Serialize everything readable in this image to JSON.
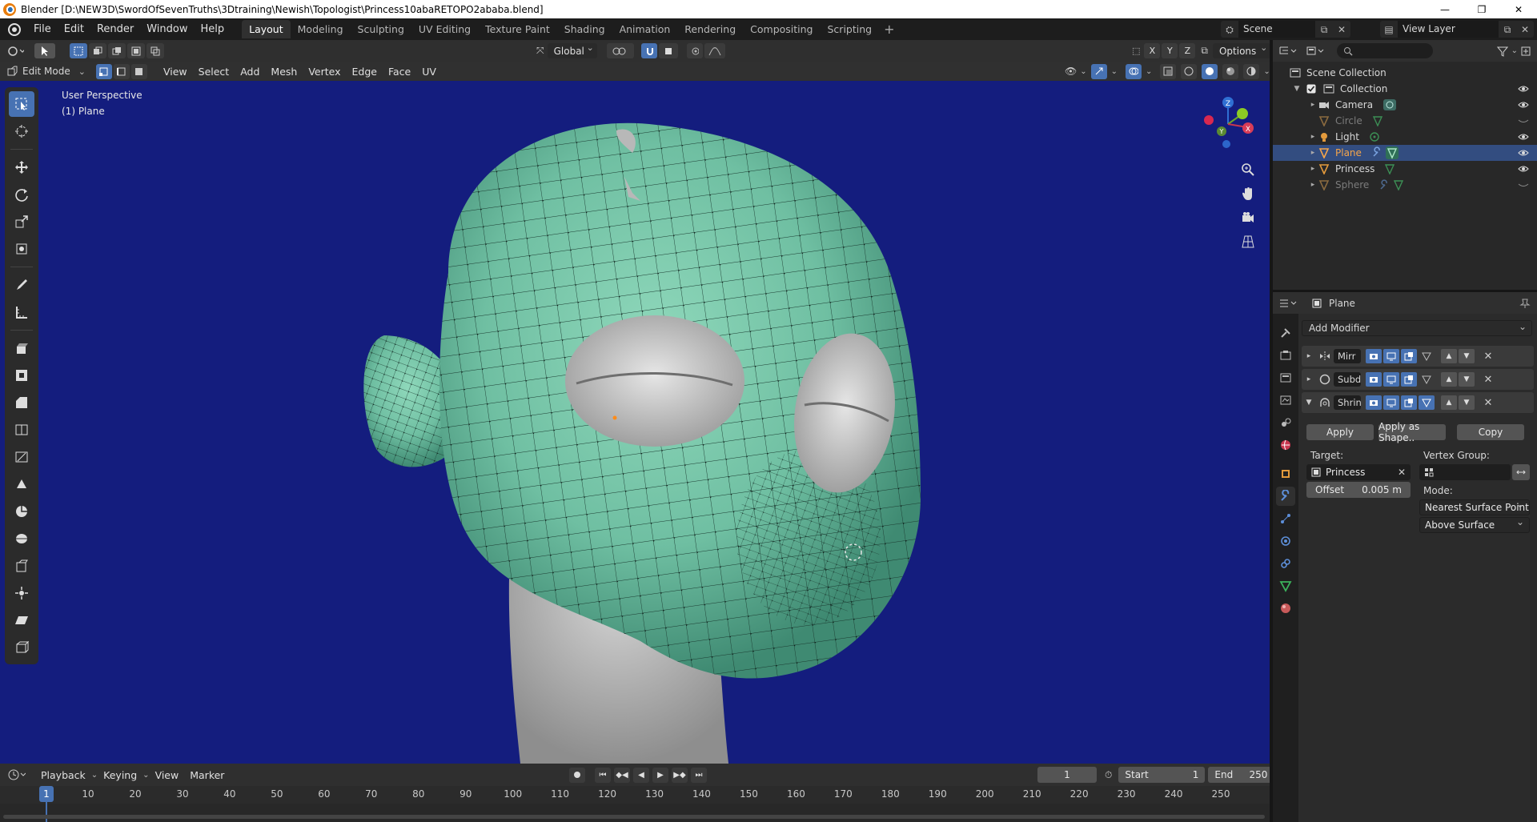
{
  "window": {
    "title": "Blender [D:\\NEW3D\\SwordOfSevenTruths\\3Dtraining\\Newish\\Topologist\\Princess10abaRETOPO2ababa.blend]",
    "minimize": "—",
    "maximize": "❐",
    "close": "✕"
  },
  "menu": [
    "File",
    "Edit",
    "Render",
    "Window",
    "Help"
  ],
  "workspaces": [
    "Layout",
    "Modeling",
    "Sculpting",
    "UV Editing",
    "Texture Paint",
    "Shading",
    "Animation",
    "Rendering",
    "Compositing",
    "Scripting"
  ],
  "workspace_add": "+",
  "scene": "Scene",
  "view_layer": "View Layer",
  "viewport_header": {
    "orientation": "Global",
    "options": "Options",
    "axes": [
      "X",
      "Y",
      "Z"
    ]
  },
  "viewport_header2": {
    "mode": "Edit Mode",
    "menus": [
      "View",
      "Select",
      "Add",
      "Mesh",
      "Vertex",
      "Edge",
      "Face",
      "UV"
    ]
  },
  "viewport": {
    "perspective": "User Perspective",
    "object": "(1) Plane",
    "background_color": "#141d7e",
    "mesh_color": "#6fbfa2"
  },
  "gizmo_axes": [
    "Z",
    "Y",
    "X"
  ],
  "outliner": {
    "root": "Scene Collection",
    "collection": "Collection",
    "items": [
      {
        "name": "Camera",
        "type": "camera",
        "dim": false,
        "visible": true
      },
      {
        "name": "Circle",
        "type": "mesh",
        "dim": true,
        "visible": false
      },
      {
        "name": "Light",
        "type": "light",
        "dim": false,
        "visible": true
      },
      {
        "name": "Plane",
        "type": "mesh",
        "dim": false,
        "visible": true,
        "selected": true
      },
      {
        "name": "Princess",
        "type": "mesh",
        "dim": false,
        "visible": true
      },
      {
        "name": "Sphere",
        "type": "mesh",
        "dim": true,
        "visible": false
      }
    ]
  },
  "properties": {
    "object_name": "Plane",
    "add_modifier": "Add Modifier",
    "modifiers": [
      {
        "name": "Mirr",
        "expanded": false
      },
      {
        "name": "Subd",
        "expanded": false
      },
      {
        "name": "Shrin",
        "expanded": true
      }
    ],
    "apply": "Apply",
    "apply_as_shape": "Apply as Shape..",
    "copy": "Copy",
    "target_label": "Target:",
    "target_value": "Princess",
    "vertex_group_label": "Vertex Group:",
    "offset_label": "Offset",
    "offset_value": "0.005 m",
    "mode_label": "Mode:",
    "mode_value": "Nearest Surface Point",
    "surface_value": "Above Surface"
  },
  "timeline": {
    "menus": [
      "Playback",
      "Keying",
      "View",
      "Marker"
    ],
    "current_frame": "1",
    "start_label": "Start",
    "start_value": "1",
    "end_label": "End",
    "end_value": "250",
    "ruler_cursor": "1",
    "ticks": [
      "10",
      "20",
      "30",
      "40",
      "50",
      "60",
      "70",
      "80",
      "90",
      "100",
      "110",
      "120",
      "130",
      "140",
      "150",
      "160",
      "170",
      "180",
      "190",
      "200",
      "210",
      "220",
      "230",
      "240",
      "250"
    ]
  }
}
